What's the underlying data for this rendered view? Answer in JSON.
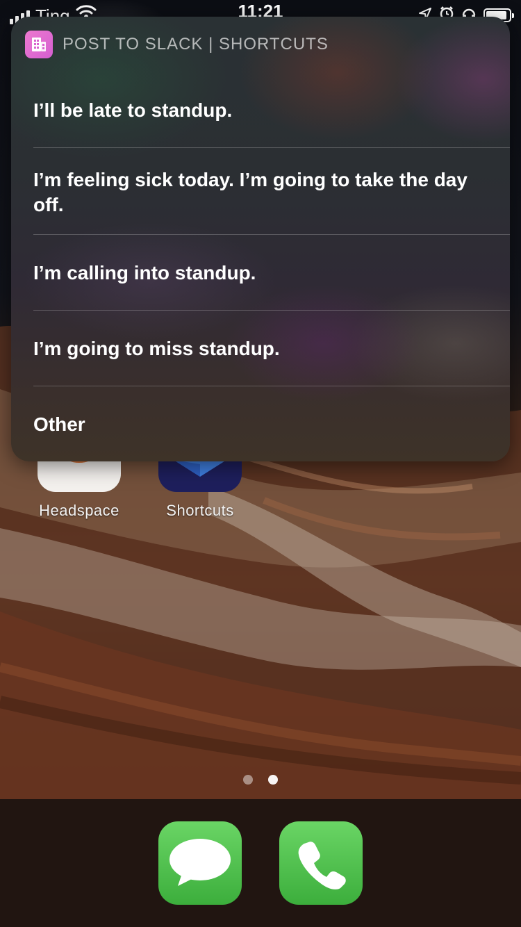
{
  "status_bar": {
    "carrier": "Ting",
    "time": "11:21",
    "battery_level": 0.9
  },
  "siri_panel": {
    "header": {
      "icon": "building-icon",
      "icon_color": "#e46fd0",
      "title": "POST TO SLACK | SHORTCUTS"
    },
    "options": [
      {
        "label": "I’ll be late to standup."
      },
      {
        "label": "I’m feeling sick today. I’m going to take the day off."
      },
      {
        "label": "I’m calling into standup."
      },
      {
        "label": "I’m going to miss standup."
      },
      {
        "label": "Other"
      }
    ]
  },
  "home_screen": {
    "apps": [
      {
        "label": "Headspace",
        "icon": "headspace-icon",
        "color": "#e0763a"
      },
      {
        "label": "Shortcuts",
        "icon": "shortcuts-icon",
        "color": "#1e1f5c"
      }
    ],
    "page_indicator": {
      "pages": 2,
      "current": 2
    }
  },
  "dock": {
    "apps": [
      {
        "name": "Messages",
        "icon": "messages-icon",
        "color": "#4cc24a"
      },
      {
        "name": "Phone",
        "icon": "phone-icon",
        "color": "#4cc24a"
      }
    ]
  }
}
